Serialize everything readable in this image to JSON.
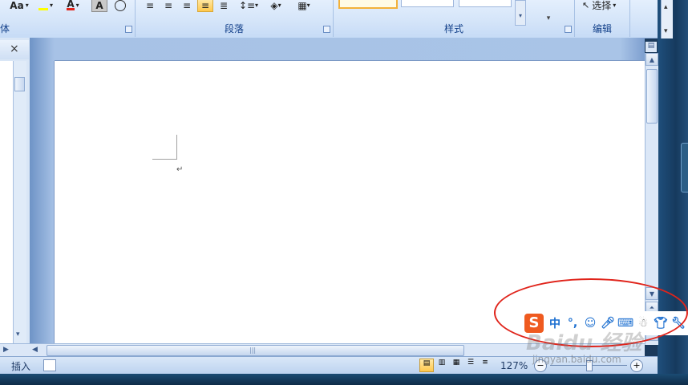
{
  "ribbon": {
    "font_group_label": "体",
    "font_case_label": "Aa",
    "font_color_letter": "A",
    "char_shade_letter": "A",
    "paragraph_group_label": "段落",
    "styles_group_label": "样式",
    "editing_group_label": "编辑",
    "select_label": "选择"
  },
  "navpane": {
    "close_glyph": "×"
  },
  "statusbar": {
    "insert_label": "插入",
    "zoom_label": "127%"
  },
  "ime": {
    "mode_label": "中",
    "logo_letter": "S"
  },
  "watermark": {
    "brand": "Baidu 经验",
    "url": "jingyan.baidu.com"
  },
  "colors": {
    "accent_red": "#e0241b",
    "ime_blue": "#1c6fd0"
  }
}
